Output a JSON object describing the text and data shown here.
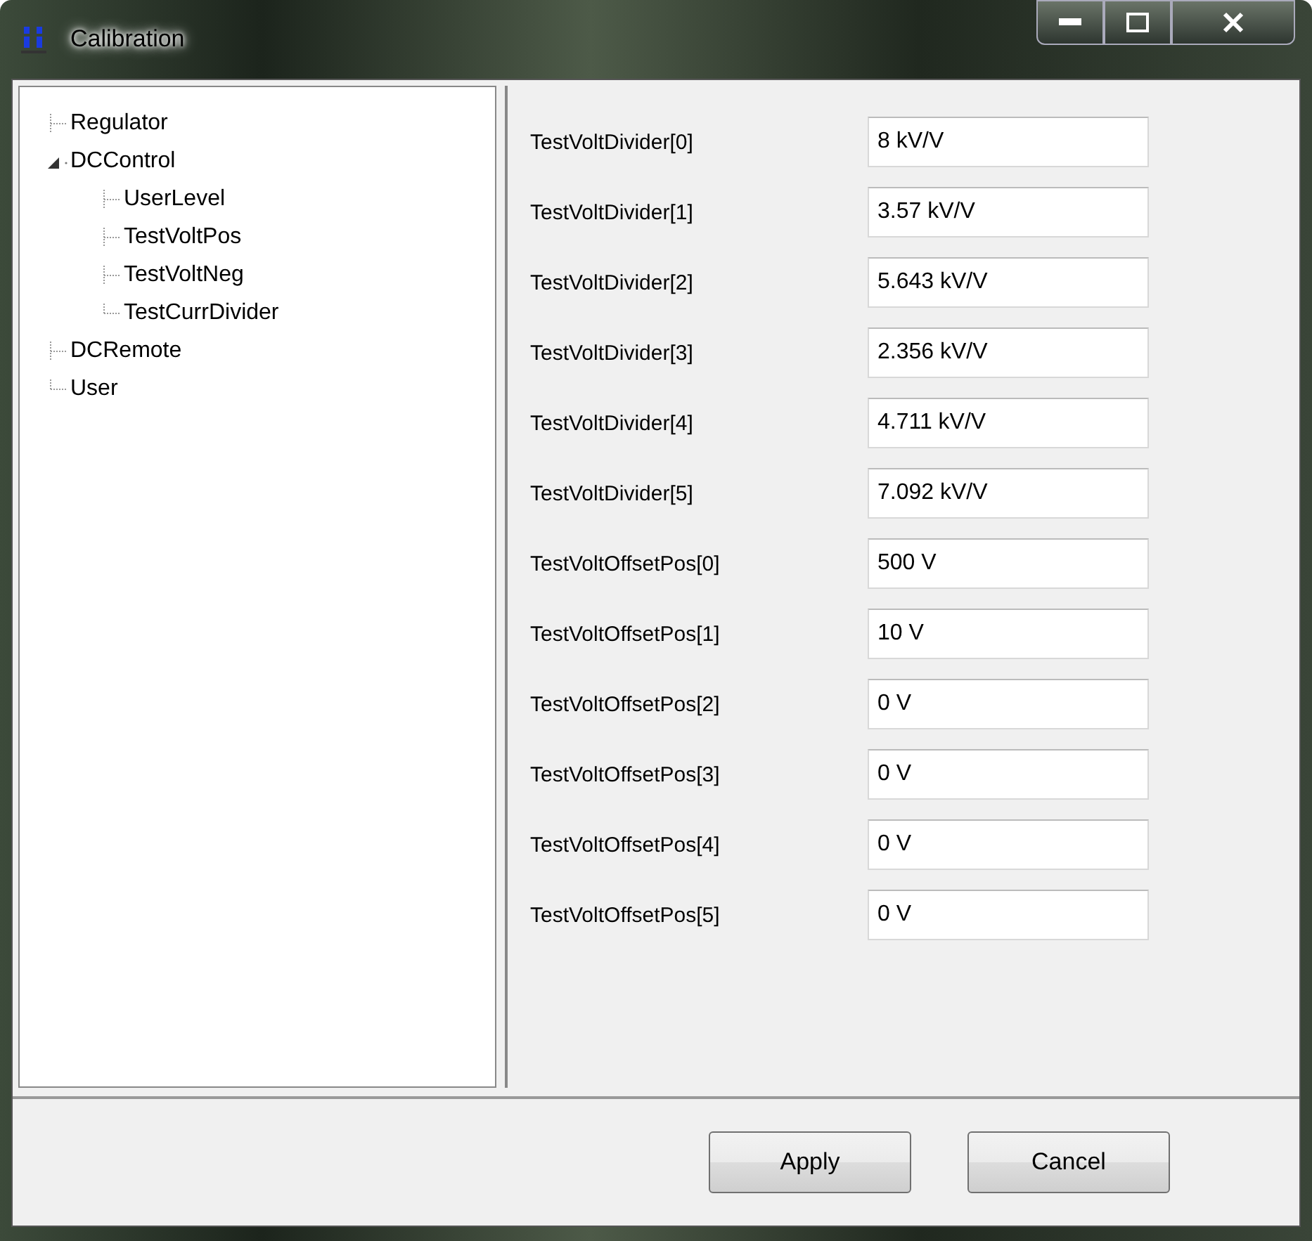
{
  "window": {
    "title": "Calibration"
  },
  "tree": [
    {
      "label": "Regulator"
    },
    {
      "label": "DCControl",
      "expanded": true,
      "children": [
        {
          "label": "UserLevel"
        },
        {
          "label": "TestVoltPos"
        },
        {
          "label": "TestVoltNeg"
        },
        {
          "label": "TestCurrDivider"
        }
      ]
    },
    {
      "label": "DCRemote"
    },
    {
      "label": "User"
    }
  ],
  "fields": [
    {
      "label": "TestVoltDivider[0]",
      "value": "8 kV/V"
    },
    {
      "label": "TestVoltDivider[1]",
      "value": "3.57 kV/V"
    },
    {
      "label": "TestVoltDivider[2]",
      "value": "5.643 kV/V"
    },
    {
      "label": "TestVoltDivider[3]",
      "value": "2.356 kV/V"
    },
    {
      "label": "TestVoltDivider[4]",
      "value": "4.711 kV/V"
    },
    {
      "label": "TestVoltDivider[5]",
      "value": "7.092 kV/V"
    },
    {
      "label": "TestVoltOffsetPos[0]",
      "value": "500 V"
    },
    {
      "label": "TestVoltOffsetPos[1]",
      "value": "10 V"
    },
    {
      "label": "TestVoltOffsetPos[2]",
      "value": "0 V"
    },
    {
      "label": "TestVoltOffsetPos[3]",
      "value": "0 V"
    },
    {
      "label": "TestVoltOffsetPos[4]",
      "value": "0 V"
    },
    {
      "label": "TestVoltOffsetPos[5]",
      "value": "0 V"
    }
  ],
  "buttons": [
    "Apply",
    "Cancel"
  ]
}
